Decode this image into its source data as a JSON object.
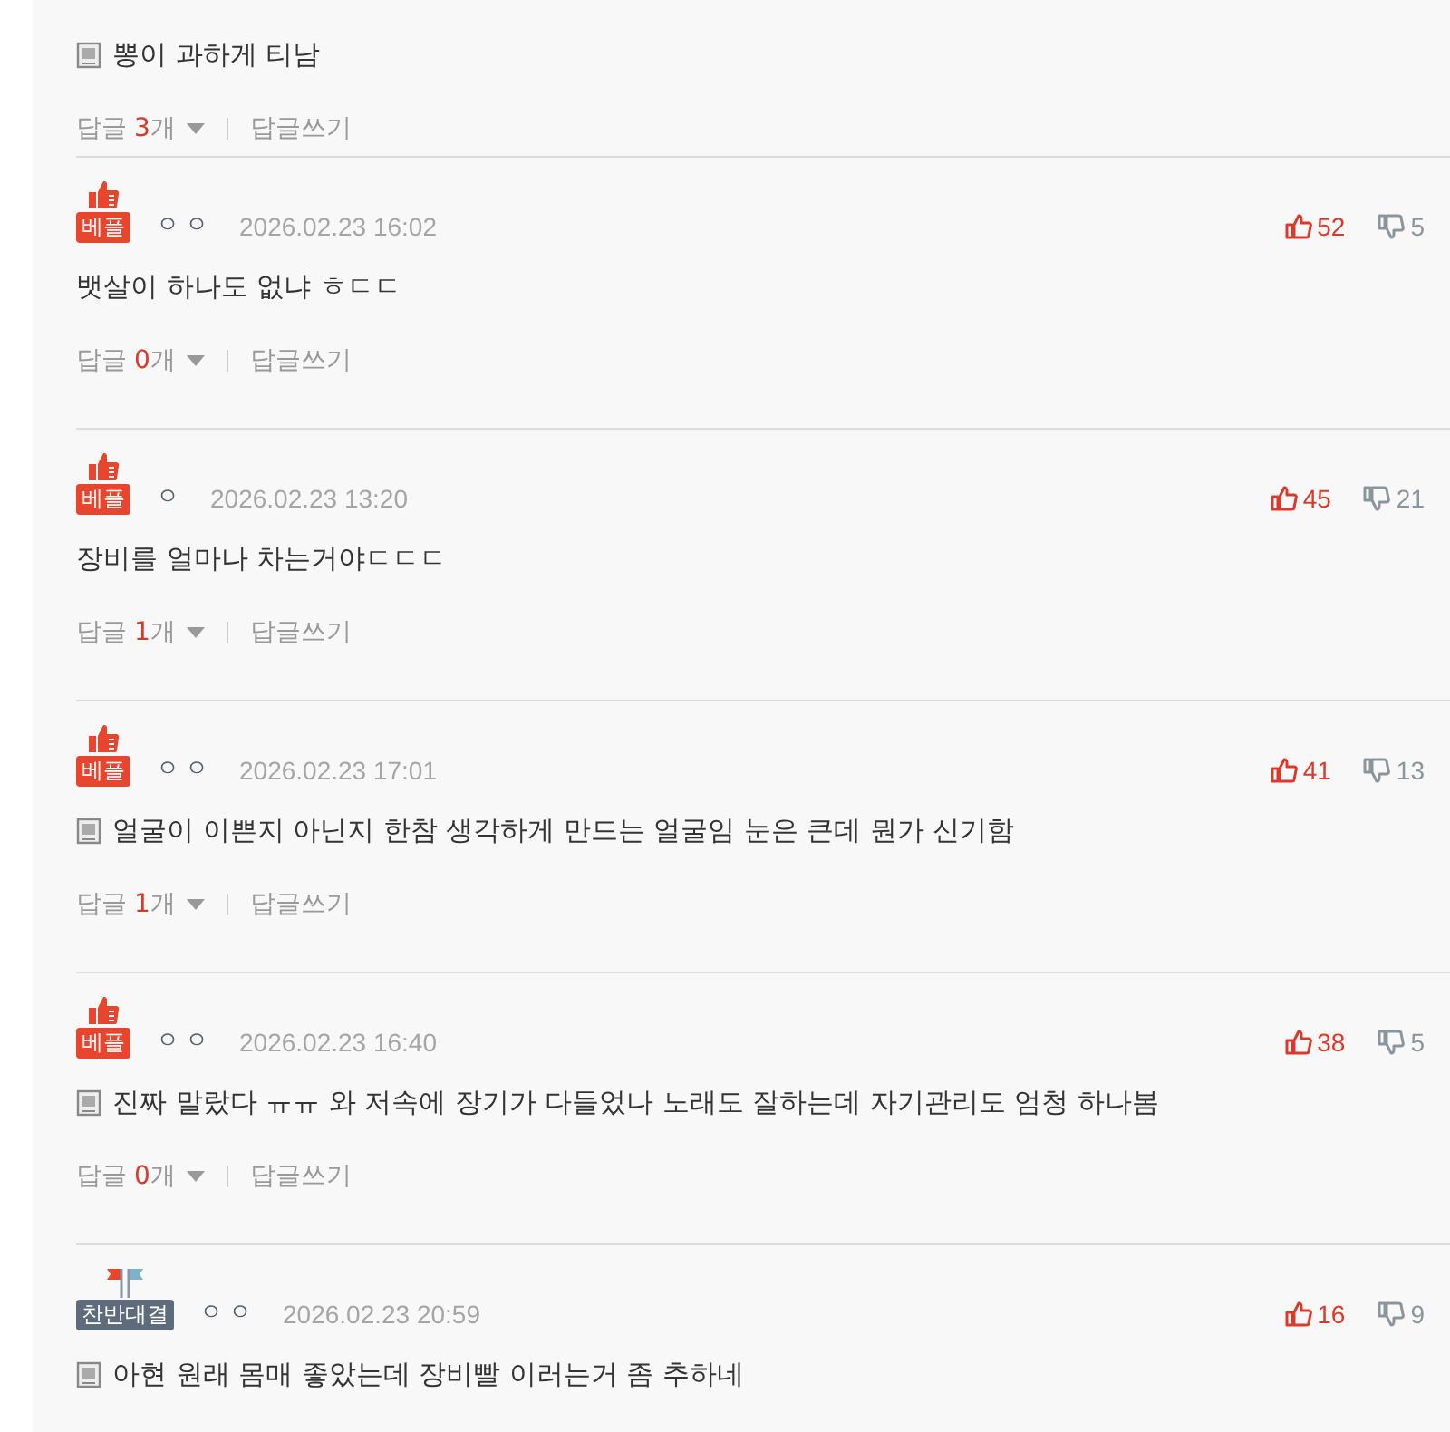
{
  "comments": [
    {
      "attachment": true,
      "text": "뽕이 과하게 티남",
      "reply_label": "답글",
      "reply_count": "3",
      "reply_unit": "개",
      "write_reply": "답글쓰기"
    },
    {
      "badge": {
        "kind": "best",
        "label": "베플"
      },
      "nickname": "ㅇㅇ",
      "date": "2026.02.23 16:02",
      "up": "52",
      "down": "5",
      "attachment": false,
      "text": "뱃살이 하나도 없냐 ㅎㄷㄷ",
      "reply_label": "답글",
      "reply_count": "0",
      "reply_unit": "개",
      "write_reply": "답글쓰기"
    },
    {
      "badge": {
        "kind": "best",
        "label": "베플"
      },
      "nickname": "ㅇ",
      "date": "2026.02.23 13:20",
      "up": "45",
      "down": "21",
      "attachment": false,
      "text": "장비를 얼마나 차는거야ㄷㄷㄷ",
      "reply_label": "답글",
      "reply_count": "1",
      "reply_unit": "개",
      "write_reply": "답글쓰기"
    },
    {
      "badge": {
        "kind": "best",
        "label": "베플"
      },
      "nickname": "ㅇㅇ",
      "date": "2026.02.23 17:01",
      "up": "41",
      "down": "13",
      "attachment": true,
      "text": "얼굴이 이쁜지 아닌지 한참 생각하게 만드는 얼굴임 눈은 큰데 뭔가 신기함",
      "reply_label": "답글",
      "reply_count": "1",
      "reply_unit": "개",
      "write_reply": "답글쓰기"
    },
    {
      "badge": {
        "kind": "best",
        "label": "베플"
      },
      "nickname": "ㅇㅇ",
      "date": "2026.02.23 16:40",
      "up": "38",
      "down": "5",
      "attachment": true,
      "text": "진짜 말랐다 ㅠㅠ 와 저속에 장기가 다들었나 노래도 잘하는데 자기관리도 엄청 하나봄",
      "reply_label": "답글",
      "reply_count": "0",
      "reply_unit": "개",
      "write_reply": "답글쓰기"
    },
    {
      "badge": {
        "kind": "versus",
        "label": "찬반대결"
      },
      "nickname": "ㅇㅇ",
      "date": "2026.02.23 20:59",
      "up": "16",
      "down": "9",
      "attachment": true,
      "text": "아현 원래 몸매 좋았는데 장비빨 이러는거 좀 추하네"
    }
  ]
}
